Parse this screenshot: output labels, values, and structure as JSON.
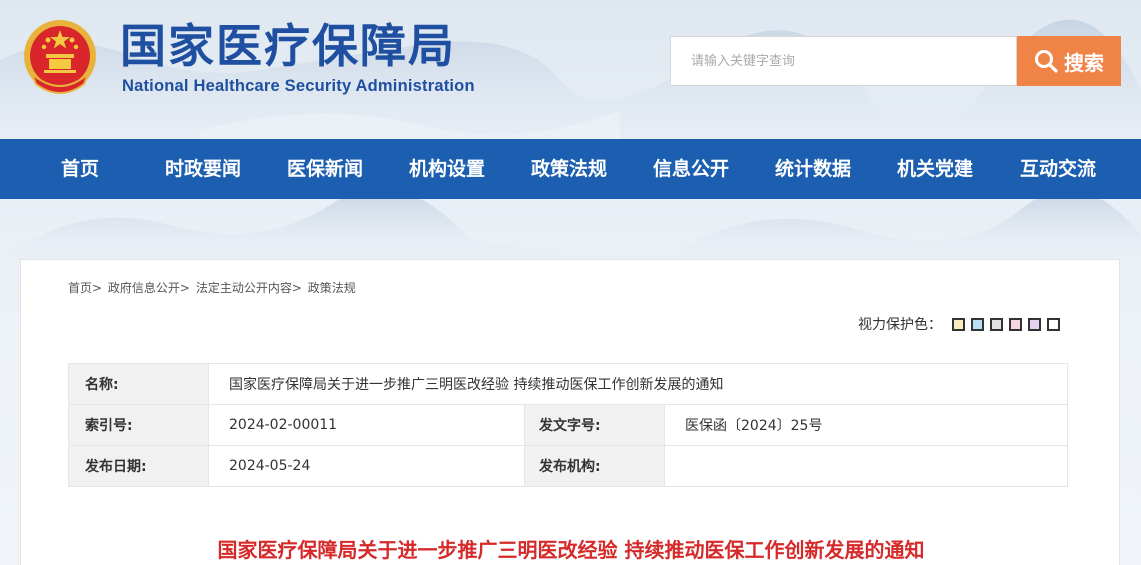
{
  "header": {
    "site_title_cn": "国家医疗保障局",
    "site_title_en": "National Healthcare Security Administration",
    "search_placeholder": "请输入关键字查询",
    "search_button": "搜索"
  },
  "nav": {
    "items": [
      "首页",
      "时政要闻",
      "医保新闻",
      "机构设置",
      "政策法规",
      "信息公开",
      "统计数据",
      "机关党建",
      "互动交流"
    ]
  },
  "breadcrumb": {
    "items": [
      "首页",
      "政府信息公开",
      "法定主动公开内容",
      "政策法规"
    ],
    "separator": ">"
  },
  "eye_care": {
    "label": "视力保护色：",
    "swatches": [
      "#f7efbf",
      "#b9dff5",
      "#e2e2e2",
      "#f6d6de",
      "#e4d0f0",
      "#ffffff"
    ]
  },
  "info": {
    "name_label": "名称:",
    "name_value": "国家医疗保障局关于进一步推广三明医改经验 持续推动医保工作创新发展的通知",
    "index_label": "索引号:",
    "index_value": "2024-02-00011",
    "docno_label": "发文字号:",
    "docno_value": "医保函〔2024〕25号",
    "date_label": "发布日期:",
    "date_value": "2024-05-24",
    "org_label": "发布机构:",
    "org_value": ""
  },
  "doc_title": "国家医疗保障局关于进一步推广三明医改经验 持续推动医保工作创新发展的通知",
  "colors": {
    "brand_blue": "#1c5fb0",
    "search_orange": "#ef8446",
    "title_red": "#d62a2a"
  }
}
